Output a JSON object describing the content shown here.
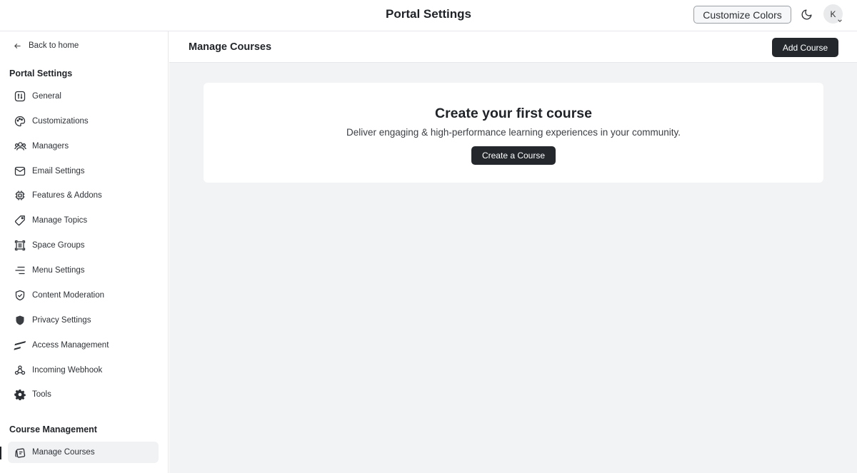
{
  "header": {
    "title": "Portal Settings",
    "customize_label": "Customize Colors",
    "avatar_initial": "K"
  },
  "sidebar": {
    "back_label": "Back to home",
    "portal_section_title": "Portal Settings",
    "items": [
      {
        "label": "General",
        "icon": "general-icon"
      },
      {
        "label": "Customizations",
        "icon": "palette-icon"
      },
      {
        "label": "Managers",
        "icon": "users-icon"
      },
      {
        "label": "Email Settings",
        "icon": "mail-icon"
      },
      {
        "label": "Features & Addons",
        "icon": "chip-icon"
      },
      {
        "label": "Manage Topics",
        "icon": "tag-icon"
      },
      {
        "label": "Space Groups",
        "icon": "space-groups-icon"
      },
      {
        "label": "Menu Settings",
        "icon": "menu-icon"
      },
      {
        "label": "Content Moderation",
        "icon": "shield-check-icon"
      },
      {
        "label": "Privacy Settings",
        "icon": "shield-icon"
      },
      {
        "label": "Access Management",
        "icon": "access-icon"
      },
      {
        "label": "Incoming Webhook",
        "icon": "webhook-icon"
      },
      {
        "label": "Tools",
        "icon": "gear-icon"
      }
    ],
    "course_section_title": "Course Management",
    "course_items": [
      {
        "label": "Manage Courses",
        "icon": "cards-icon",
        "active": true
      }
    ]
  },
  "main": {
    "title": "Manage Courses",
    "add_label": "Add Course",
    "empty": {
      "title": "Create your first course",
      "subtitle": "Deliver engaging & high-performance learning experiences in your community.",
      "button_label": "Create a Course"
    }
  },
  "colors": {
    "primary_button": "#24282d",
    "page_background": "#f2f3f5",
    "border": "#e6e7ea"
  }
}
